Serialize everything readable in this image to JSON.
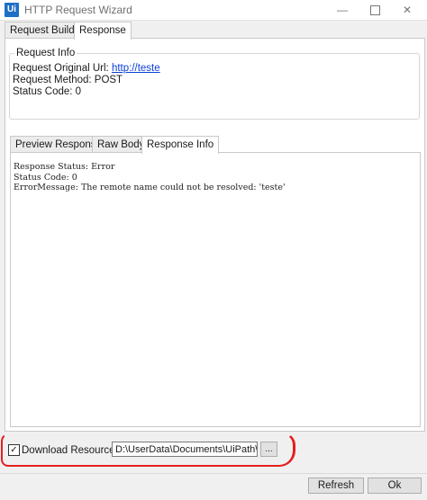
{
  "window": {
    "app_icon_text": "Ui",
    "title": "HTTP Request Wizard",
    "minimize_glyph": "—",
    "close_glyph": "✕"
  },
  "tabs": [
    {
      "label": "Request Builder",
      "active": false
    },
    {
      "label": "Response",
      "active": true
    }
  ],
  "request_info": {
    "legend": "Request Info",
    "url_label": "Request Original Url:",
    "url_value": "http://teste",
    "method_text": "Request Method: POST",
    "status_text": "Status Code: 0"
  },
  "subtabs": [
    {
      "label": "Preview Response",
      "active": false
    },
    {
      "label": "Raw Body",
      "active": false
    },
    {
      "label": "Response Info",
      "active": true
    }
  ],
  "response_info": {
    "lines": [
      "Response Status: Error",
      "Status Code: 0",
      "ErrorMessage: The remote name could not be resolved: 'teste'"
    ]
  },
  "download": {
    "checked": true,
    "check_glyph": "✓",
    "label": "Download Resource",
    "path": "D:\\UserData\\Documents\\UiPath\\Teste",
    "browse_label": "..."
  },
  "buttons": {
    "refresh": "Refresh",
    "ok": "Ok"
  },
  "colors": {
    "annotation": "#e41f1f",
    "link": "#0b3fd6",
    "app_icon": "#1f6fc5"
  }
}
